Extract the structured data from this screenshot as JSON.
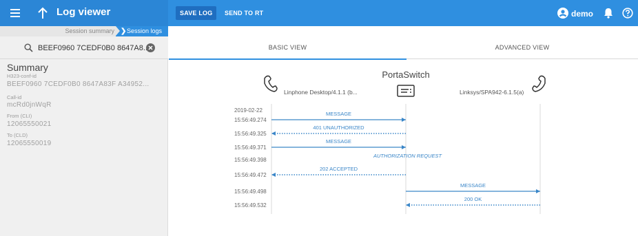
{
  "header": {
    "title": "Log viewer",
    "save_log": "SAVE LOG",
    "send_to_rt": "SEND TO RT",
    "user": "demo",
    "accent": "#2f8fe0"
  },
  "breadcrumb": {
    "items": [
      "Session summary",
      "Session logs"
    ]
  },
  "search": {
    "value": "BEEF0960 7CEDF0B0 8647A8..."
  },
  "summary": {
    "title": "Summary",
    "fields": [
      {
        "label": "H323-conf-id",
        "value": "BEEF0960 7CEDF0B0 8647A83F A34952..."
      },
      {
        "label": "Call-id",
        "value": "mcRd0jnWqR"
      },
      {
        "label": "From (CLI)",
        "value": "12065550021"
      },
      {
        "label": "To (CLD)",
        "value": "12065550019"
      }
    ]
  },
  "tabs": [
    "BASIC VIEW",
    "ADVANCED VIEW"
  ],
  "flow": {
    "center_title": "PortaSwitch",
    "left_party": "Linphone Desktop/4.1.1 (b...",
    "right_party": "Linksys/SPA942-6.1.5(a)",
    "date": "2019-02-22",
    "events": [
      {
        "time": "15:56:49.274",
        "label": "MESSAGE",
        "from": "left",
        "to": "center",
        "style": "solid"
      },
      {
        "time": "15:56:49.325",
        "label": "401 UNAUTHORIZED",
        "from": "center",
        "to": "left",
        "style": "dotted"
      },
      {
        "time": "15:56:49.371",
        "label": "MESSAGE",
        "from": "left",
        "to": "center",
        "style": "solid"
      },
      {
        "time": "15:56:49.398",
        "label": "AUTHORIZATION REQUEST",
        "from": "center",
        "to": "center",
        "style": "note"
      },
      {
        "time": "15:56:49.472",
        "label": "202 ACCEPTED",
        "from": "center",
        "to": "left",
        "style": "dotted"
      },
      {
        "time": "15:56:49.498",
        "label": "MESSAGE",
        "from": "center",
        "to": "right",
        "style": "solid"
      },
      {
        "time": "15:56:49.532",
        "label": "200 OK",
        "from": "right",
        "to": "center",
        "style": "dotted"
      }
    ],
    "arrow_color": "#3a86c8"
  }
}
